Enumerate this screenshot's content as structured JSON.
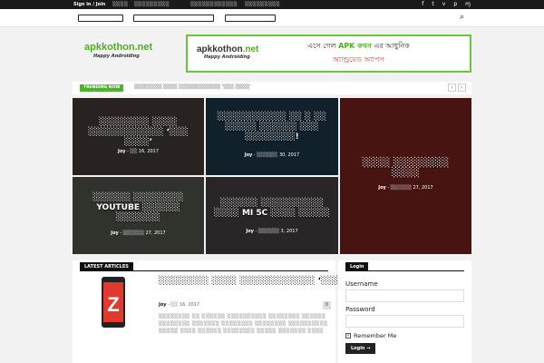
{
  "topbar": {
    "auth": "Sign in / Join",
    "extra": "░░░░",
    "links": [
      "░░░░░░░░░",
      "░░░░░░░░░░░░",
      "░░░░░░░░░"
    ],
    "social": [
      "f",
      "t",
      "v",
      "p",
      "ɱ"
    ]
  },
  "nav": {
    "items": [
      "░░░░░░░░",
      "░░░░░ ░░░░░░░░",
      "░░░░░░░░░"
    ]
  },
  "logo": {
    "name_main": "apkkothon",
    "name_tld": ".net",
    "tagline": "Happy Androiding"
  },
  "ad": {
    "name_main": "apkkothon",
    "name_tld": ".net",
    "tagline": "Happy Androiding",
    "slogan_pre": "এসে গেল ",
    "slogan_apk": "APK কথন",
    "slogan_post": " এর আধুনিক",
    "slogan_line2": "অ্যান্ড্রয়েড অ্যাপস"
  },
  "trending": {
    "badge": "TRENDING NOW",
    "headline": "░░░░░░░░ ░░░░ ░░░░░░░░░░░░ ‘░░░ ░░░░’",
    "prev": "‹",
    "next": "›"
  },
  "tiles": [
    {
      "title": "░░░░░░░░ ░░░░ ░░░░░░░░░░░░ ‘░░░ ░░░░’",
      "author": "Joy",
      "date": "░░ 16, 2017",
      "color": "#5a4e4a"
    },
    {
      "title": "░░░░░░░░░░░ ░░ ░ ░░ ░░░░░ ░░░░░░ ░░░ ░░░░░░░░!",
      "author": "Joy",
      "date": "░░░░░░ 30, 2017",
      "color": "#274a63"
    },
    {
      "title": "░░░░ ░░░░░░░░ ░░░░",
      "author": "Joy",
      "date": "░░░░░░ 27, 2017",
      "color": "#6d1f1b"
    },
    {
      "title": "░░░░░░ ░░░░░░░░ YOUTUBE ░░░░░░ ░░░░░░░",
      "author": "Joy",
      "date": "░░░░░░ 27, 2017",
      "color": "#6b6f62"
    },
    {
      "title": "░░░░░░ ░░░░░░░░░░ ░░░░ MI 5C ░░░░ ░░░░░",
      "author": "Joy",
      "date": "░░░░░░ 3, 2017",
      "color": "#5e5458"
    }
  ],
  "latest": {
    "label": "LATEST ARTICLES",
    "title": "░░░░░░░░ ░░░░ ░░░░░░░░░░░░ ‘░░░ ░░░░’",
    "author": "Joy",
    "date": "░░ 16, 2017",
    "comments": "0",
    "excerpt": "░░░░░░░░ ░░ ░░░░░░ ░░░░░░░░░░ ░░░░░░░░ ░░░░░░ ░░░░░░░░ ░░░░░░░ ░░░░░░░░ ░░░░░░░░ ░░░░░░░░░░ ░░░░░ ░░░░ ░░░░░░ ░░░░░░░░ ░░░░░ ░░░░░░░ ░░░░"
  },
  "login": {
    "label": "Login",
    "username_label": "Username",
    "password_label": "Password",
    "remember_label": "Remember Me",
    "remember_check": "✓",
    "button": "Login →"
  }
}
